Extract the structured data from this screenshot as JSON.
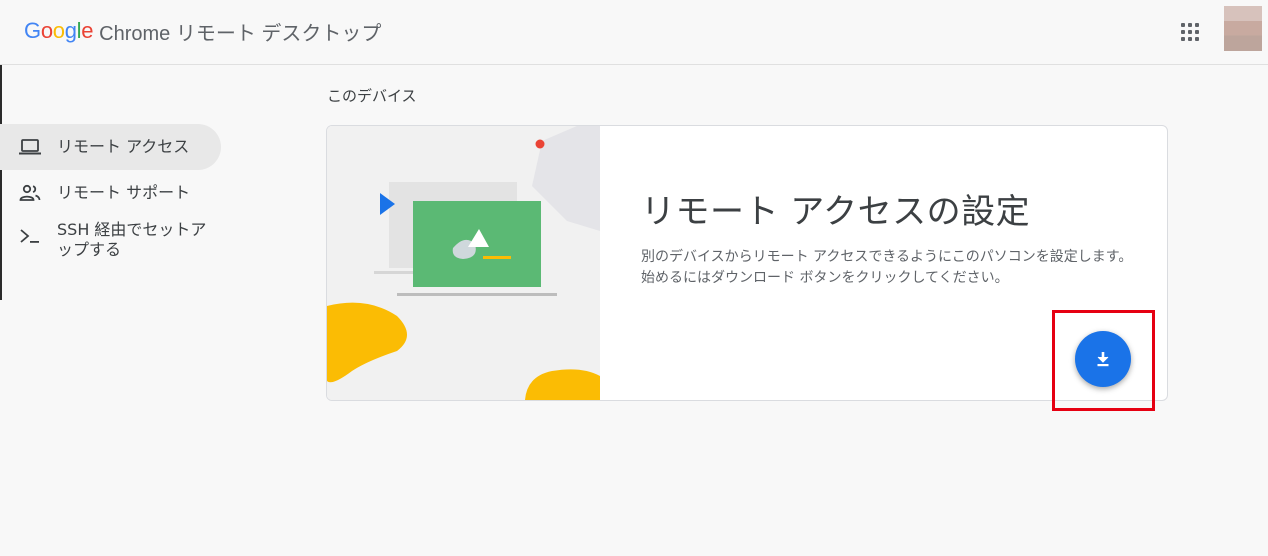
{
  "header": {
    "logo_letters": [
      {
        "ch": "G",
        "color": "#4285F4"
      },
      {
        "ch": "o",
        "color": "#EA4335"
      },
      {
        "ch": "o",
        "color": "#FBBC05"
      },
      {
        "ch": "g",
        "color": "#4285F4"
      },
      {
        "ch": "l",
        "color": "#34A853"
      },
      {
        "ch": "e",
        "color": "#EA4335"
      }
    ],
    "logo_text": "Google",
    "product_name": "Chrome リモート デスクトップ",
    "apps_icon": "apps-grid-icon",
    "avatar": "account-avatar"
  },
  "sidebar": {
    "items": [
      {
        "label": "リモート アクセス",
        "icon": "laptop-icon",
        "active": true
      },
      {
        "label": "リモート サポート",
        "icon": "people-icon",
        "active": false
      },
      {
        "label": "SSH 経由でセットアップする",
        "label_line1": "SSH 経由でセットア",
        "label_line2": "ップする",
        "icon": "terminal-icon",
        "active": false
      }
    ]
  },
  "main": {
    "section_label": "このデバイス",
    "card": {
      "title": "リモート アクセスの設定",
      "description": "別のデバイスからリモート アクセスできるようにこのパソコンを設定します。始めるにはダウンロード ボタンをクリックしてください。",
      "download_icon": "download-icon"
    }
  },
  "colors": {
    "accent_blue": "#1a73e8",
    "highlight_red": "#e60012",
    "illus_green": "#5bb974",
    "illus_yellow": "#fbbc04"
  }
}
